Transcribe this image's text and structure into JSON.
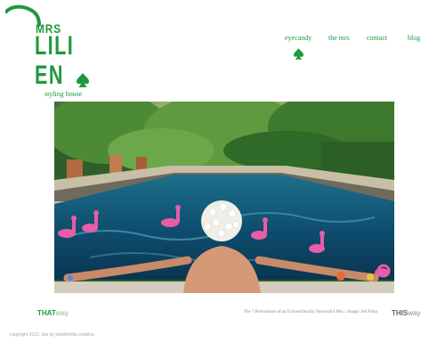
{
  "logo": {
    "line1": "MRS",
    "line2": "LILI",
    "line3": "EN",
    "tagline": "styling house",
    "brand_color": "#1e9a3c"
  },
  "nav": {
    "items": [
      {
        "label": "eyecandy"
      },
      {
        "label": "the mrs"
      },
      {
        "label": "contact"
      },
      {
        "label": "blog"
      }
    ],
    "active_icon": "spade-icon"
  },
  "footer": {
    "prev": {
      "strong": "THAT",
      "light": "way"
    },
    "caption": "The 7 Persuasions of an Extraordinarily Successful Mrs. | Image: Jen Fisko",
    "next": {
      "strong": "THIS",
      "light": "way"
    },
    "copyright": "copyright 2015. site by pomfemilia creative."
  }
}
